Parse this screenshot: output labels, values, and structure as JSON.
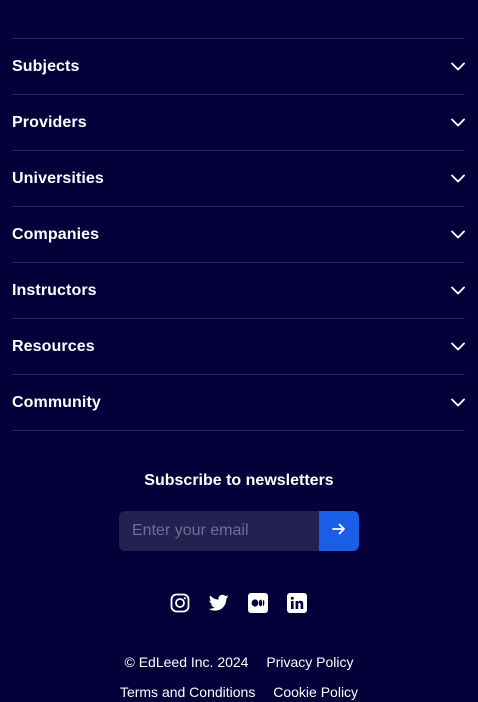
{
  "accordion": {
    "items": [
      {
        "label": "Subjects"
      },
      {
        "label": "Providers"
      },
      {
        "label": "Universities"
      },
      {
        "label": "Companies"
      },
      {
        "label": "Instructors"
      },
      {
        "label": "Resources"
      },
      {
        "label": "Community"
      }
    ],
    "icon": "chevron-down-icon"
  },
  "newsletter": {
    "title": "Subscribe to newsletters",
    "email_placeholder": "Enter your email",
    "submit_icon": "arrow-right-icon",
    "accent": "#1a5ee8"
  },
  "social": {
    "icons": [
      "instagram-icon",
      "twitter-icon",
      "medium-icon",
      "linkedin-icon"
    ]
  },
  "footer": {
    "copyright": "© EdLeed Inc. 2024",
    "privacy": "Privacy Policy",
    "terms": "Terms and Conditions",
    "cookie": "Cookie Policy"
  },
  "colors": {
    "background": "#04013a",
    "input_background": "#232150"
  }
}
